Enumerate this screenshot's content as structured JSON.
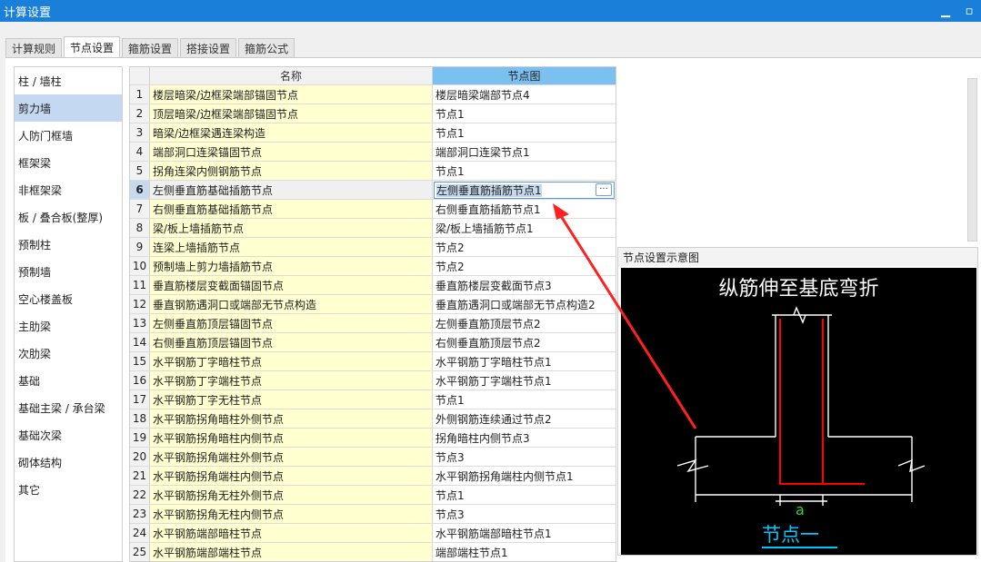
{
  "window": {
    "title": "计算设置",
    "min_glyph": "▁",
    "max_glyph": "▫"
  },
  "tabs": [
    "计算规则",
    "节点设置",
    "箍筋设置",
    "搭接设置",
    "箍筋公式"
  ],
  "active_tab": 1,
  "sidebar": {
    "items": [
      "柱 / 墙柱",
      "剪力墙",
      "人防门框墙",
      "框架梁",
      "非框架梁",
      "板 / 叠合板(整厚)",
      "预制柱",
      "预制墙",
      "空心楼盖板",
      "主肋梁",
      "次肋梁",
      "基础",
      "基础主梁 / 承台梁",
      "基础次梁",
      "砌体结构",
      "其它"
    ],
    "active_index": 1
  },
  "grid": {
    "col_name": "名称",
    "col_node": "节点图",
    "selected_row": 6,
    "rows": [
      {
        "num": "1",
        "name": "楼层暗梁/边框梁端部锚固节点",
        "node": "楼层暗梁端部节点4"
      },
      {
        "num": "2",
        "name": "顶层暗梁/边框梁端部锚固节点",
        "node": "节点1"
      },
      {
        "num": "3",
        "name": "暗梁/边框梁遇连梁构造",
        "node": "节点1"
      },
      {
        "num": "4",
        "name": "端部洞口连梁锚固节点",
        "node": "端部洞口连梁节点1"
      },
      {
        "num": "5",
        "name": "拐角连梁内侧钢筋节点",
        "node": "节点1"
      },
      {
        "num": "6",
        "name": "左侧垂直筋基础插筋节点",
        "node": "左侧垂直筋插筋节点1"
      },
      {
        "num": "7",
        "name": "右侧垂直筋基础插筋节点",
        "node": "右侧垂直筋插筋节点1"
      },
      {
        "num": "8",
        "name": "梁/板上墙插筋节点",
        "node": "梁/板上墙插筋节点1"
      },
      {
        "num": "9",
        "name": "连梁上墙插筋节点",
        "node": "节点2"
      },
      {
        "num": "10",
        "name": "预制墙上剪力墙插筋节点",
        "node": "节点2"
      },
      {
        "num": "11",
        "name": "垂直筋楼层变截面锚固节点",
        "node": "垂直筋楼层变截面节点3"
      },
      {
        "num": "12",
        "name": "垂直钢筋遇洞口或端部无节点构造",
        "node": "垂直筋遇洞口或端部无节点构造2"
      },
      {
        "num": "13",
        "name": "左侧垂直筋顶层锚固节点",
        "node": "左侧垂直筋顶层节点2"
      },
      {
        "num": "14",
        "name": "右侧垂直筋顶层锚固节点",
        "node": "右侧垂直筋顶层节点2"
      },
      {
        "num": "15",
        "name": "水平钢筋丁字暗柱节点",
        "node": "水平钢筋丁字暗柱节点1"
      },
      {
        "num": "16",
        "name": "水平钢筋丁字端柱节点",
        "node": "水平钢筋丁字端柱节点1"
      },
      {
        "num": "17",
        "name": "水平钢筋丁字无柱节点",
        "node": "节点1"
      },
      {
        "num": "18",
        "name": "水平钢筋拐角暗柱外侧节点",
        "node": "外侧钢筋连续通过节点2"
      },
      {
        "num": "19",
        "name": "水平钢筋拐角暗柱内侧节点",
        "node": "拐角暗柱内侧节点3"
      },
      {
        "num": "20",
        "name": "水平钢筋拐角端柱外侧节点",
        "node": "节点3"
      },
      {
        "num": "21",
        "name": "水平钢筋拐角端柱内侧节点",
        "node": "水平钢筋拐角端柱内侧节点1"
      },
      {
        "num": "22",
        "name": "水平钢筋拐角无柱外侧节点",
        "node": "节点1"
      },
      {
        "num": "23",
        "name": "水平钢筋拐角无柱内侧节点",
        "node": "节点3"
      },
      {
        "num": "24",
        "name": "水平钢筋端部暗柱节点",
        "node": "水平钢筋端部暗柱节点1"
      },
      {
        "num": "25",
        "name": "水平钢筋端部端柱节点",
        "node": "端部端柱节点1"
      }
    ]
  },
  "diagram": {
    "title": "节点设置示意图",
    "main_text": "纵筋伸至基底弯折",
    "dim_label": "a",
    "node_label": "节点一",
    "colors": {
      "bg": "#000000",
      "lines": "#ffffff",
      "rebar": "#ff0000",
      "dim": "#39d139",
      "caption": "#00c8ff",
      "arrow": "#ff2020"
    }
  },
  "icons": {
    "edit_button": "ellipsis-icon",
    "minimize": "minimize-icon",
    "maximize": "maximize-icon"
  }
}
